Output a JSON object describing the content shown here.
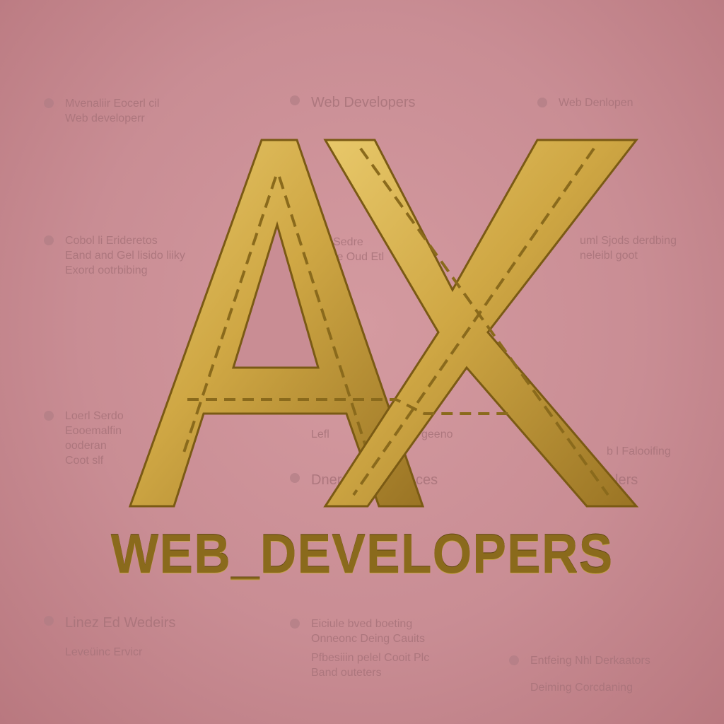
{
  "logo": {
    "monogram": "AX",
    "brand_text": "WEB_DEVELOPERS"
  },
  "background_texts": [
    {
      "lines": [
        "Mvenaliir Eocerl cil",
        "Web developerr"
      ]
    },
    {
      "lines": [
        "Web Developers"
      ]
    },
    {
      "lines": [
        "Web Denlopen"
      ]
    },
    {
      "lines": [
        "Cobol li Erideretos",
        "Eand and Gel lisido liiky",
        "Exord ootrbibing"
      ]
    },
    {
      "lines": [
        "il lkl Sedre",
        "Kuirce Oud Etl"
      ]
    },
    {
      "lines": [
        "uml Sjods derdbing",
        "neleibl goot"
      ]
    },
    {
      "lines": [
        "Loerl Serdo",
        "Eooemalfin",
        "ooderan",
        "Coot slf"
      ]
    },
    {
      "lines": [
        "Lefl",
        "geeno"
      ]
    },
    {
      "lines": [
        "Dnerc",
        "ces"
      ]
    },
    {
      "lines": [
        "b l Falooifing"
      ]
    },
    {
      "lines": [
        "lers"
      ]
    },
    {
      "lines": [
        "Linez Ed Wedeirs"
      ]
    },
    {
      "lines": [
        "Leveüinc Ervicr"
      ]
    },
    {
      "lines": [
        "Eiciule bved boeting",
        "Onneonc Deing Cauits"
      ]
    },
    {
      "lines": [
        "Entfeing Nhl Derkaators"
      ]
    },
    {
      "lines": [
        "Deiming Corcdaning"
      ]
    },
    {
      "lines": [
        "Pfbesiiin pelel Cooit Plc",
        "Band outeters"
      ]
    }
  ],
  "colors": {
    "background": "#c98d94",
    "gold_light": "#e3c36a",
    "gold_dark": "#8a6a1c",
    "muted_text": "#a8737a"
  }
}
